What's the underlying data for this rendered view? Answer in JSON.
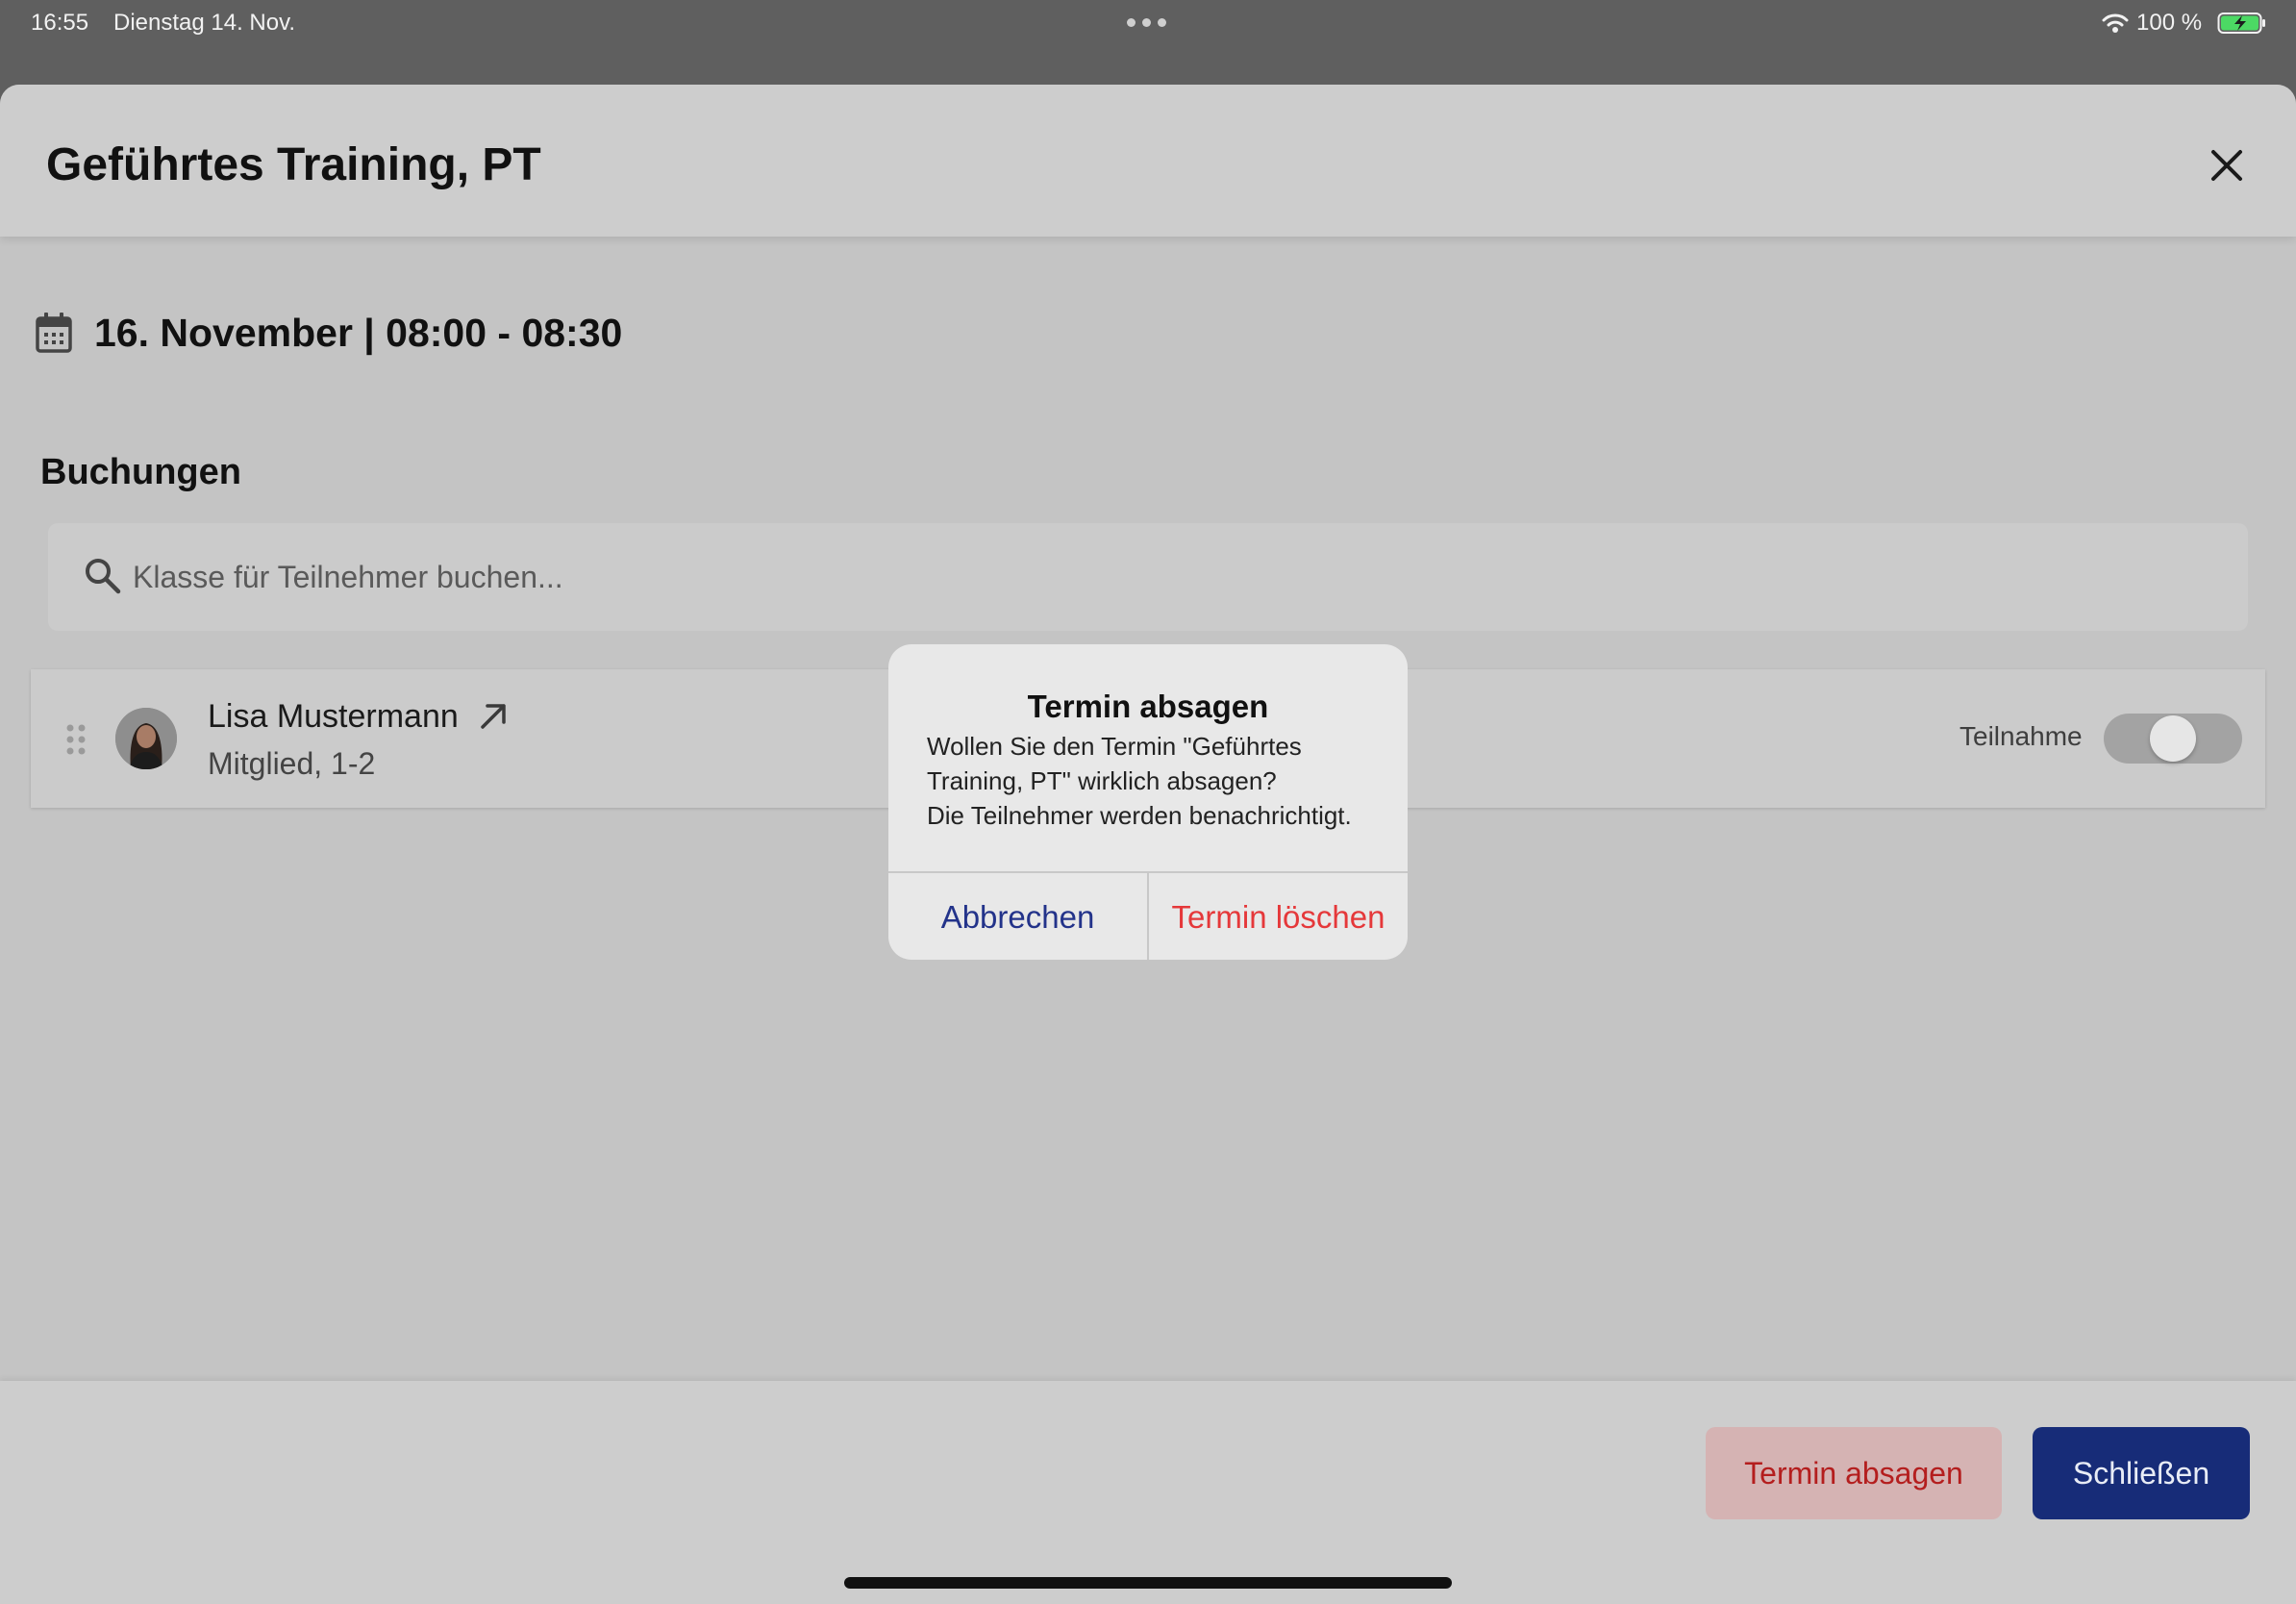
{
  "status_bar": {
    "time": "16:55",
    "date": "Dienstag 14. Nov.",
    "battery": "100 %"
  },
  "sheet": {
    "title": "Geführtes Training, PT",
    "date_line": "16. November | 08:00 - 08:30",
    "section_title": "Buchungen",
    "search": {
      "placeholder": "Klasse für Teilnehmer buchen..."
    },
    "booking": {
      "name": "Lisa Mustermann",
      "meta": "Mitglied, 1-2",
      "toggle_label": "Teilnahme",
      "toggle_on": false
    },
    "footer": {
      "cancel_label": "Termin absagen",
      "close_label": "Schließen"
    }
  },
  "alert": {
    "title": "Termin absagen",
    "message": "Wollen Sie den Termin \"Geführtes Training, PT\" wirklich absagen?\nDie Teilnehmer werden benachrichtigt.",
    "cancel_label": "Abbrechen",
    "confirm_label": "Termin löschen"
  },
  "colors": {
    "accent": "#172c78",
    "danger": "#e5383a",
    "danger_text": "#b41e1e"
  }
}
